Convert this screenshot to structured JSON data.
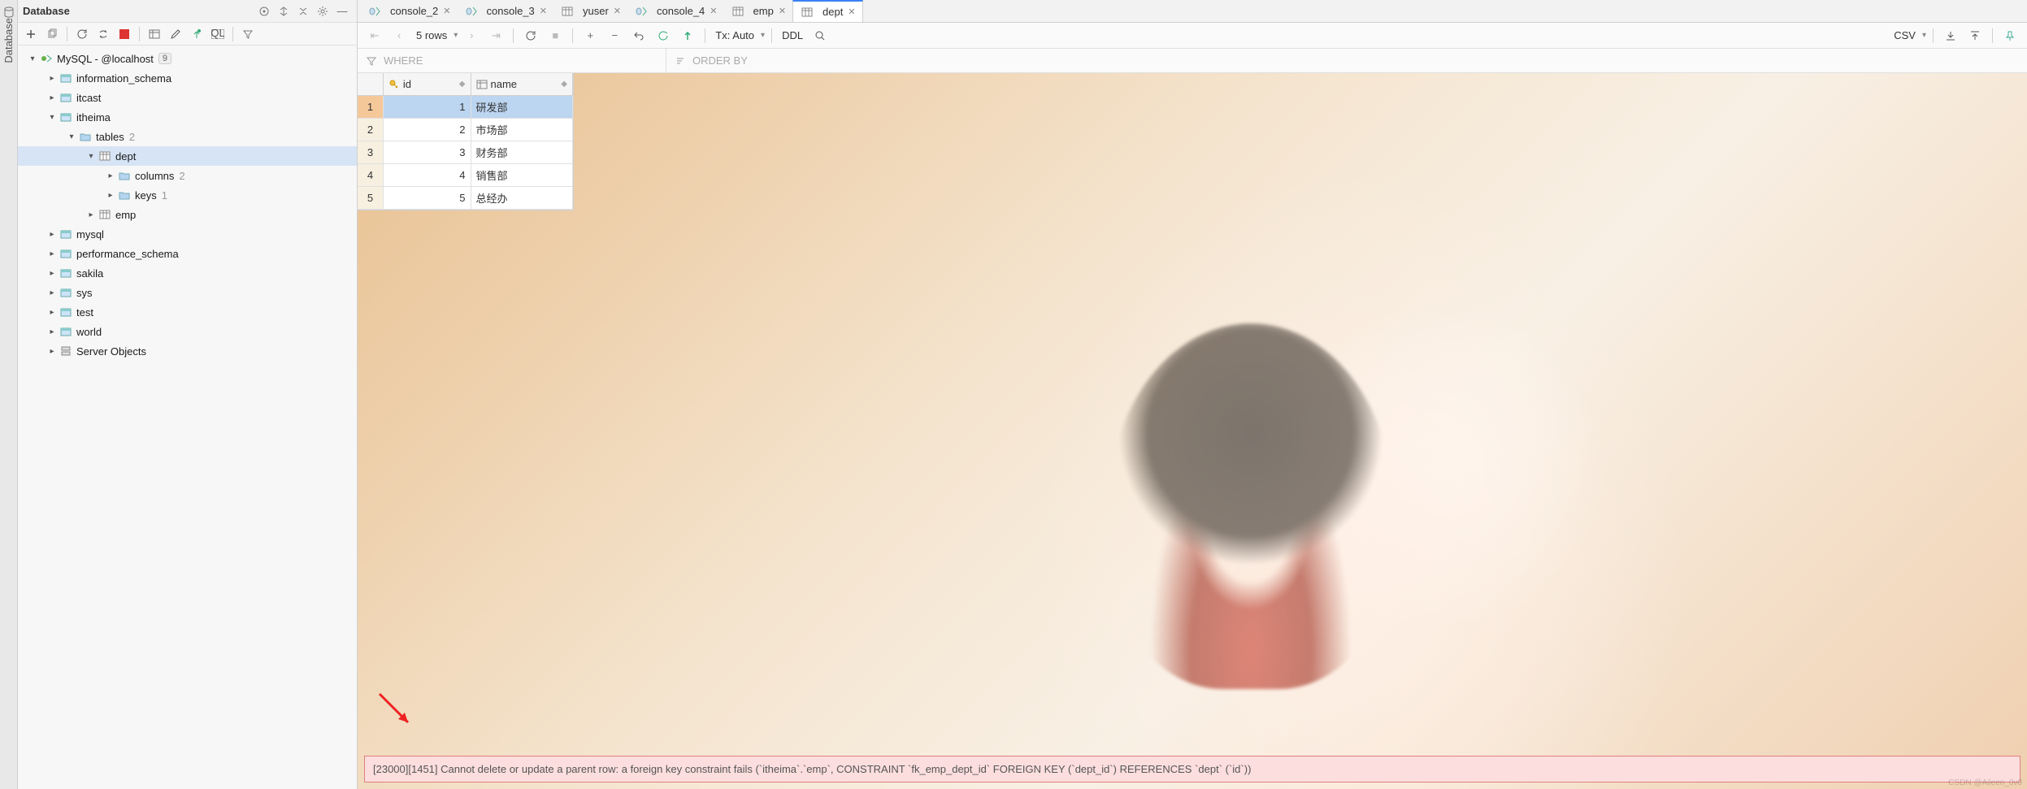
{
  "sidebar": {
    "title": "Database",
    "connection": {
      "label": "MySQL - @localhost",
      "count": "9"
    },
    "nodes": {
      "info_schema": "information_schema",
      "itcast": "itcast",
      "itheima": "itheima",
      "tables": "tables",
      "tables_cnt": "2",
      "dept": "dept",
      "columns": "columns",
      "columns_cnt": "2",
      "keys": "keys",
      "keys_cnt": "1",
      "emp": "emp",
      "mysql": "mysql",
      "perf": "performance_schema",
      "sakila": "sakila",
      "sys": "sys",
      "test": "test",
      "world": "world",
      "server": "Server Objects"
    }
  },
  "tabs": [
    {
      "label": "console_2",
      "kind": "sql"
    },
    {
      "label": "console_3",
      "kind": "sql"
    },
    {
      "label": "yuser",
      "kind": "tbl"
    },
    {
      "label": "console_4",
      "kind": "sql"
    },
    {
      "label": "emp",
      "kind": "tbl"
    },
    {
      "label": "dept",
      "kind": "tbl",
      "active": true
    }
  ],
  "toolbar": {
    "rows": "5 rows",
    "tx": "Tx: Auto",
    "ddl": "DDL",
    "csv": "CSV"
  },
  "filters": {
    "where": "WHERE",
    "order": "ORDER BY"
  },
  "columns": {
    "id": "id",
    "name": "name"
  },
  "rows": [
    {
      "n": "1",
      "id": "1",
      "name": "研发部",
      "sel": true
    },
    {
      "n": "2",
      "id": "2",
      "name": "市场部"
    },
    {
      "n": "3",
      "id": "3",
      "name": "财务部"
    },
    {
      "n": "4",
      "id": "4",
      "name": "销售部"
    },
    {
      "n": "5",
      "id": "5",
      "name": "总经办"
    }
  ],
  "error": "[23000][1451] Cannot delete or update a parent row: a foreign key constraint fails (`itheima`.`emp`, CONSTRAINT `fk_emp_dept_id` FOREIGN KEY (`dept_id`) REFERENCES `dept` (`id`))",
  "watermark": "CSDN @Aileen_0v0"
}
